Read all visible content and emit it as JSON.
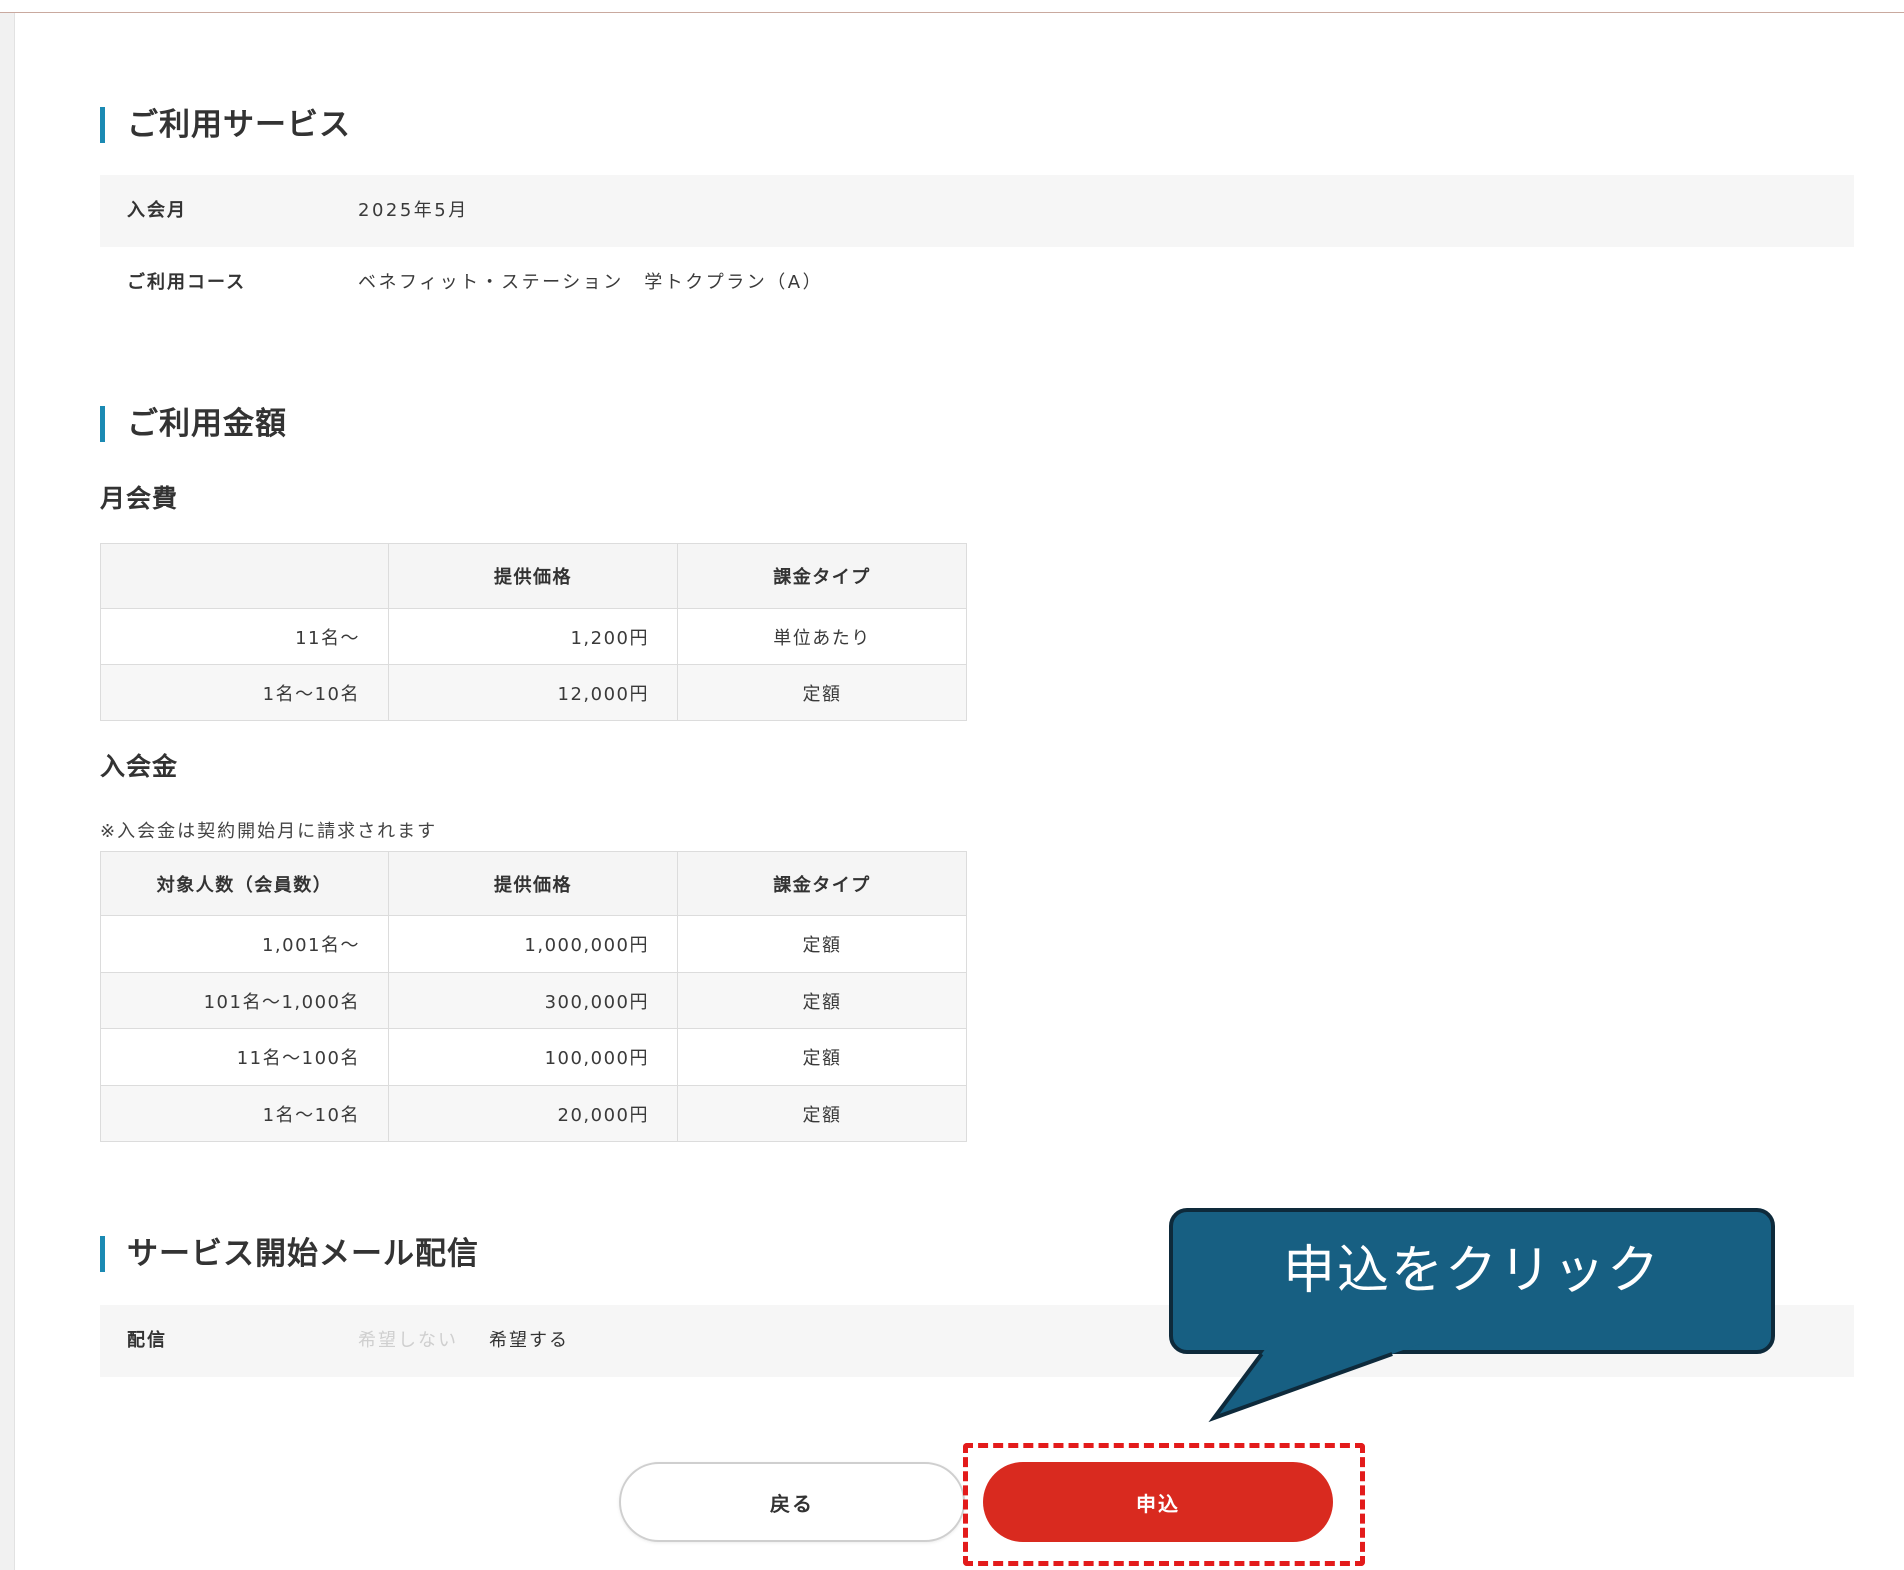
{
  "colors": {
    "accent": "#1b8ab3",
    "top_border": "#c9a99f",
    "apply_button": "#d92a1f",
    "callout_background": "#175f82",
    "highlight_border": "#e31b1b"
  },
  "service_section": {
    "title": "ご利用サービス",
    "rows": [
      {
        "label": "入会月",
        "value": "2025年5月"
      },
      {
        "label": "ご利用コース",
        "value": "ベネフィット・ステーション　学トクプラン（A）"
      }
    ]
  },
  "fee_section": {
    "title": "ご利用金額",
    "monthly": {
      "title": "月会費",
      "headers": [
        "",
        "提供価格",
        "課金タイプ"
      ],
      "rows": [
        [
          "11名〜",
          "1,200円",
          "単位あたり"
        ],
        [
          "1名〜10名",
          "12,000円",
          "定額"
        ]
      ]
    },
    "enrollment": {
      "title": "入会金",
      "note": "※入会金は契約開始月に請求されます",
      "headers": [
        "対象人数（会員数）",
        "提供価格",
        "課金タイプ"
      ],
      "rows": [
        [
          "1,001名〜",
          "1,000,000円",
          "定額"
        ],
        [
          "101名〜1,000名",
          "300,000円",
          "定額"
        ],
        [
          "11名〜100名",
          "100,000円",
          "定額"
        ],
        [
          "1名〜10名",
          "20,000円",
          "定額"
        ]
      ]
    }
  },
  "mail_section": {
    "title": "サービス開始メール配信",
    "label": "配信",
    "options": [
      {
        "label": "希望しない",
        "selected": false
      },
      {
        "label": "希望する",
        "selected": true
      }
    ]
  },
  "buttons": {
    "back": "戻る",
    "apply": "申込"
  },
  "callout": {
    "text": "申込をクリック"
  }
}
